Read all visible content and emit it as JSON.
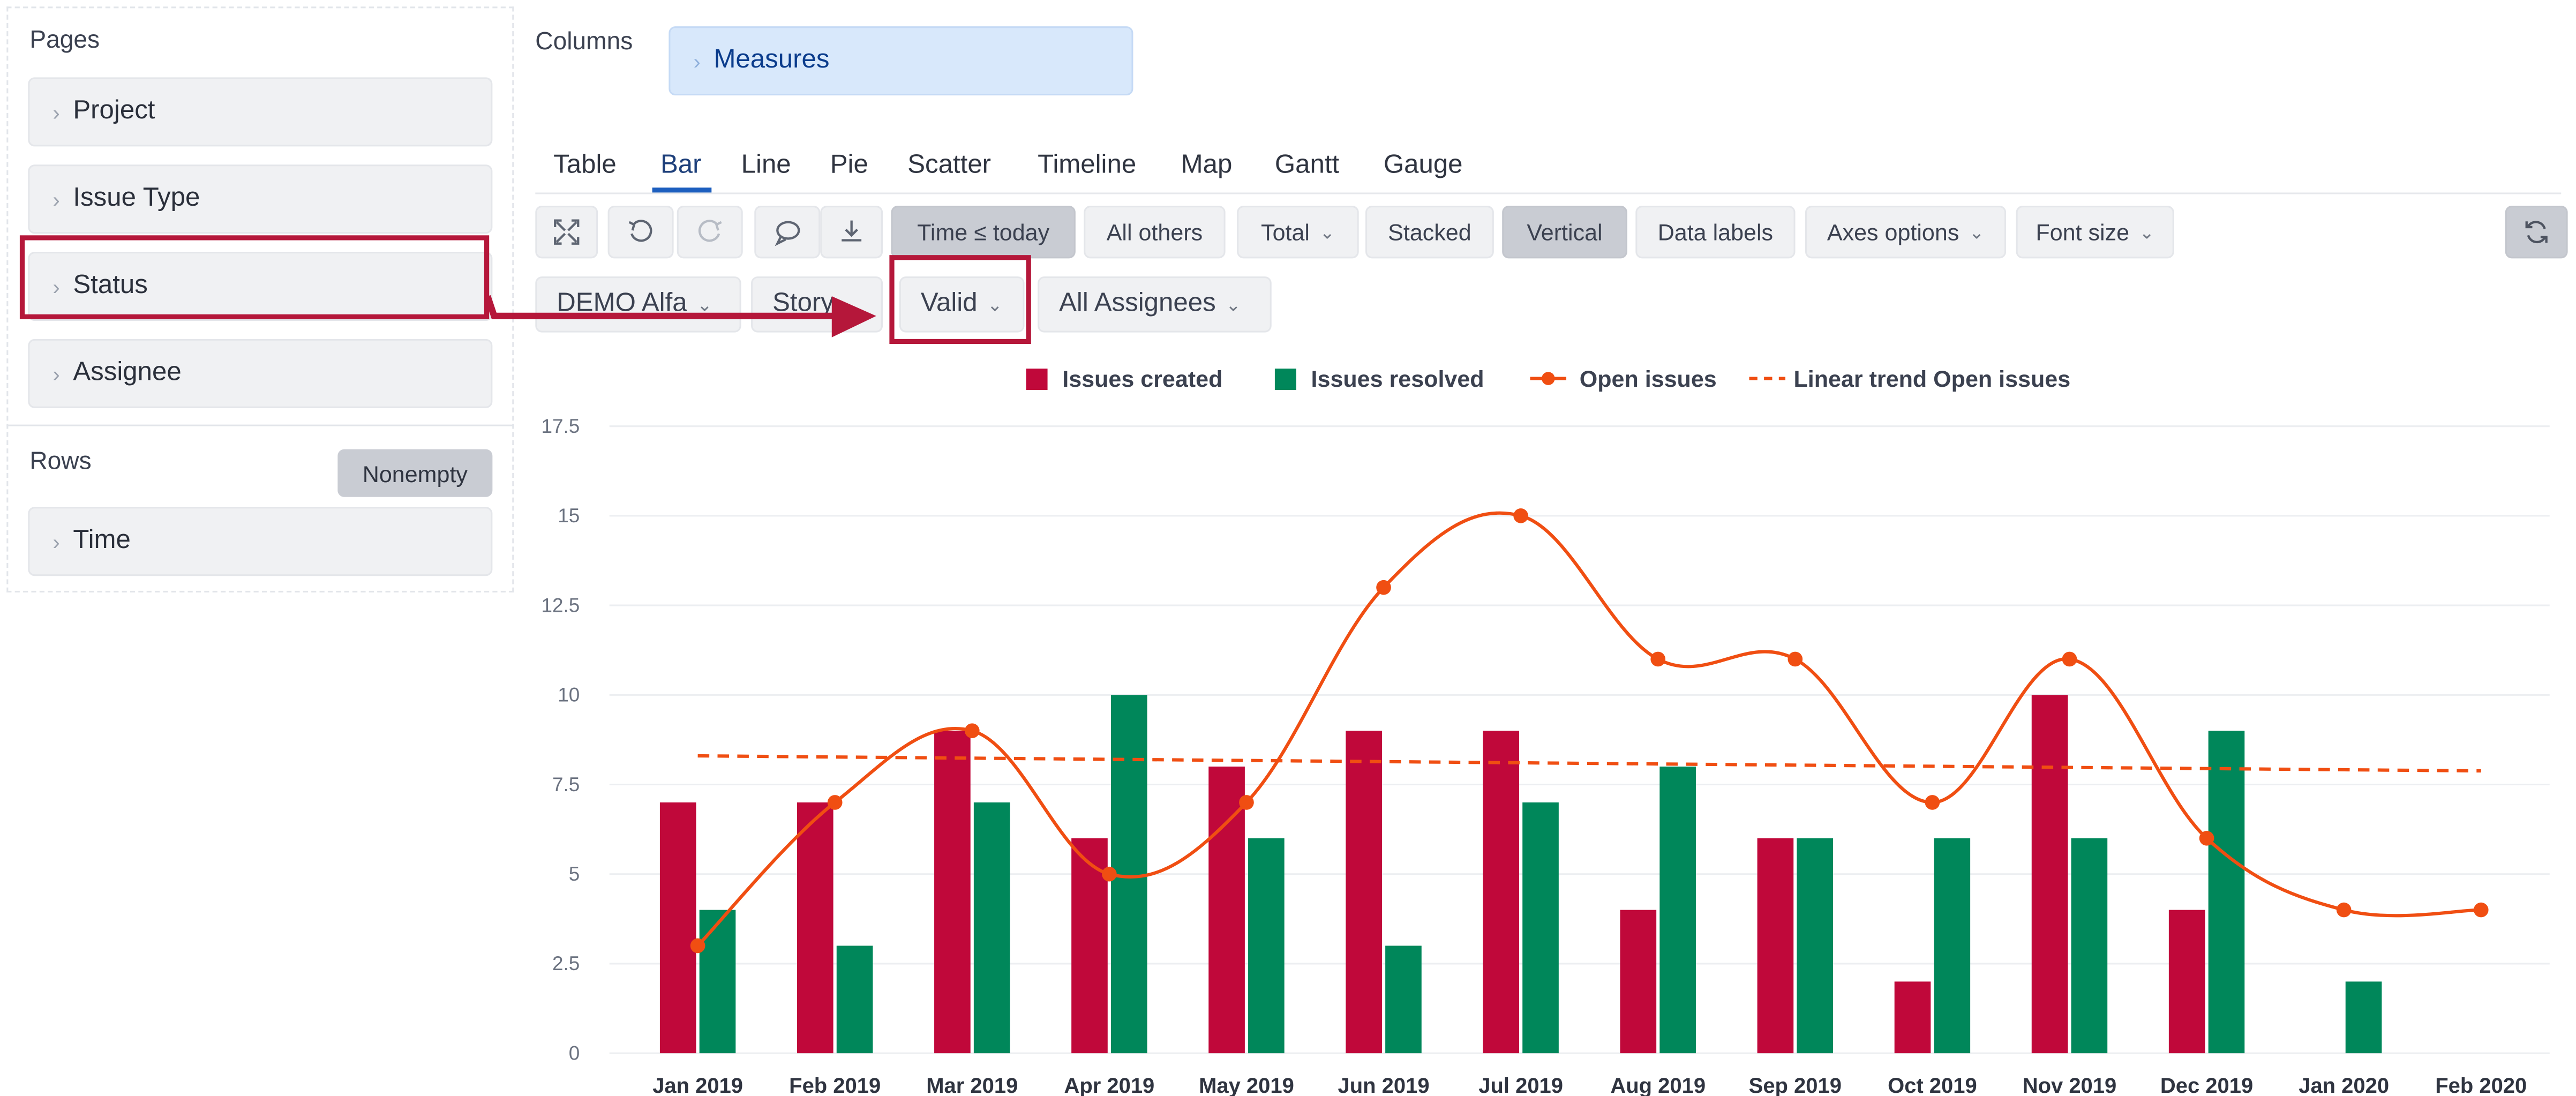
{
  "left_panel": {
    "pages_title": "Pages",
    "pages": [
      "Project",
      "Issue Type",
      "Status",
      "Assignee"
    ],
    "rows_title": "Rows",
    "nonempty_label": "Nonempty",
    "rows": [
      "Time"
    ]
  },
  "columns": {
    "title": "Columns",
    "items": [
      "Measures"
    ]
  },
  "tabs": {
    "items": [
      "Table",
      "Bar",
      "Line",
      "Pie",
      "Scatter",
      "Timeline",
      "Map",
      "Gantt",
      "Gauge"
    ],
    "active": "Bar"
  },
  "toolbar": {
    "icons": [
      "expand-icon",
      "undo-icon",
      "redo-icon",
      "comment-icon",
      "export-icon"
    ],
    "time_filter": "Time ≤ today",
    "all_others": "All others",
    "total": "Total",
    "stacked": "Stacked",
    "vertical": "Vertical",
    "data_labels": "Data labels",
    "axes_options": "Axes options",
    "font_size": "Font size",
    "refresh_icon": "refresh-icon"
  },
  "filters": {
    "project": "DEMO Alfa",
    "issue_type": "Story",
    "status": "Valid",
    "assignee": "All Assignees"
  },
  "colors": {
    "created": "#c0083a",
    "resolved": "#00875a",
    "open": "#f04e12",
    "trend": "#f04e12",
    "annotation": "#b5173a",
    "measures_bg": "#d8e8fb",
    "measures_text": "#0b3c8c"
  },
  "chart_data": {
    "type": "bar",
    "categories": [
      "Jan 2019",
      "Feb 2019",
      "Mar 2019",
      "Apr 2019",
      "May 2019",
      "Jun 2019",
      "Jul 2019",
      "Aug 2019",
      "Sep 2019",
      "Oct 2019",
      "Nov 2019",
      "Dec 2019",
      "Jan 2020",
      "Feb 2020"
    ],
    "series": [
      {
        "name": "Issues created",
        "type": "bar",
        "values": [
          7,
          7,
          9,
          6,
          8,
          9,
          9,
          4,
          6,
          2,
          10,
          4,
          null,
          null
        ]
      },
      {
        "name": "Issues resolved",
        "type": "bar",
        "values": [
          4,
          3,
          7,
          10,
          6,
          3,
          7,
          8,
          6,
          6,
          6,
          9,
          2,
          null
        ]
      },
      {
        "name": "Open issues",
        "type": "line",
        "values": [
          3,
          7,
          9,
          5,
          7,
          13,
          15,
          11,
          11,
          7,
          11,
          6,
          4,
          4
        ]
      },
      {
        "name": "Linear trend Open issues",
        "type": "line-dashed",
        "values": [
          8.3,
          8.27,
          8.24,
          8.21,
          8.18,
          8.15,
          8.12,
          8.08,
          8.05,
          8.02,
          7.98,
          7.95,
          7.91,
          7.88
        ]
      }
    ],
    "yticks": [
      "0",
      "2.5",
      "5",
      "7.5",
      "10",
      "12.5",
      "15",
      "17.5"
    ],
    "ylim": [
      0,
      17.5
    ],
    "grid": true,
    "legend_position": "top-center"
  }
}
